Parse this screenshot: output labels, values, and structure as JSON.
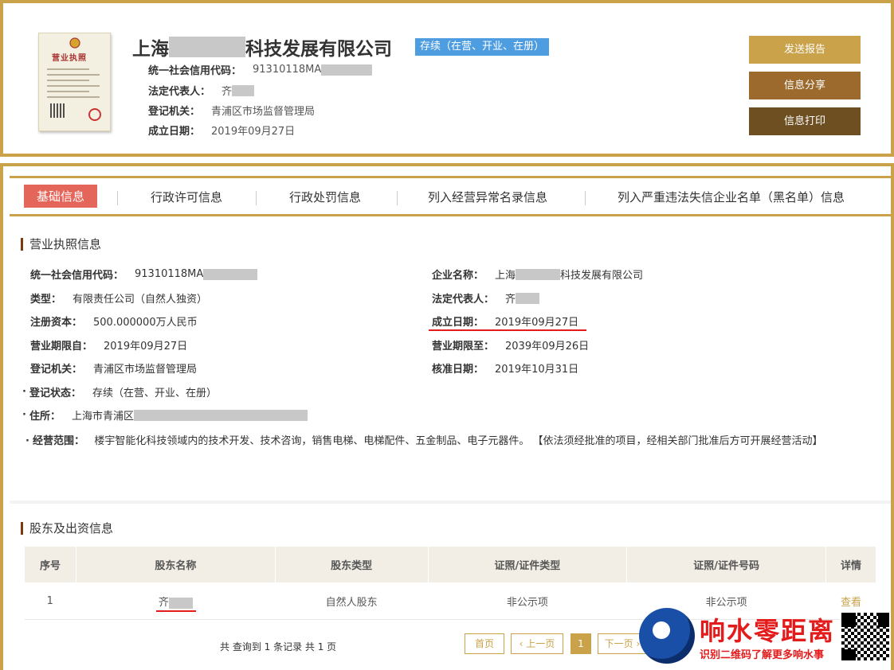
{
  "header": {
    "license_title": "营业执照",
    "company_prefix": "上海",
    "company_suffix": "科技发展有限公司",
    "status": "存续（在营、开业、在册）",
    "credit_code_label": "统一社会信用代码：",
    "credit_code": "91310118MA",
    "legal_rep_label": "法定代表人：",
    "legal_rep": "齐",
    "authority_label": "登记机关：",
    "authority": "青浦区市场监督管理局",
    "founded_label": "成立日期：",
    "founded": "2019年09月27日"
  },
  "actions": {
    "send": "发送报告",
    "share": "信息分享",
    "print": "信息打印"
  },
  "tabs": [
    "基础信息",
    "行政许可信息",
    "行政处罚信息",
    "列入经营异常名录信息",
    "列入严重违法失信企业名单（黑名单）信息"
  ],
  "license_section": {
    "title": "营业执照信息",
    "credit_code_label": "统一社会信用代码：",
    "credit_code": "91310118MA",
    "name_label": "企业名称：",
    "name_prefix": "上海",
    "name_suffix": "科技发展有限公司",
    "type_label": "类型：",
    "type": "有限责任公司（自然人独资）",
    "legal_rep_label": "法定代表人：",
    "legal_rep": "齐",
    "capital_label": "注册资本：",
    "capital": "500.000000万人民币",
    "founded_label": "成立日期：",
    "founded": "2019年09月27日",
    "term_from_label": "营业期限自：",
    "term_from": "2019年09月27日",
    "term_to_label": "营业期限至：",
    "term_to": "2039年09月26日",
    "authority_label": "登记机关：",
    "authority": "青浦区市场监督管理局",
    "approved_label": "核准日期：",
    "approved": "2019年10月31日",
    "reg_status_label": "登记状态：",
    "reg_status": "存续（在营、开业、在册）",
    "address_label": "住所：",
    "address": "上海市青浦区",
    "scope_label": "经营范围：",
    "scope": "楼宇智能化科技领域内的技术开发、技术咨询，销售电梯、电梯配件、五金制品、电子元器件。 【依法须经批准的项目，经相关部门批准后方可开展经营活动】"
  },
  "shareholder_section": {
    "title": "股东及出资信息",
    "columns": [
      "序号",
      "股东名称",
      "股东类型",
      "证照/证件类型",
      "证照/证件号码",
      "详情"
    ],
    "rows": [
      {
        "index": "1",
        "name": "齐",
        "type": "自然人股东",
        "cert_type": "非公示项",
        "cert_no": "非公示项",
        "detail": "查看"
      }
    ]
  },
  "pager": {
    "summary": "共 查询到 1 条记录 共 1 页",
    "first": "首页",
    "prev": "上一页",
    "current": "1",
    "next": "下一页"
  },
  "watermark": {
    "title": "响水零距离",
    "subtitle": "识别二维码了解更多响水事"
  },
  "colors": {
    "gold": "#c9a24a",
    "brown": "#9b6a2c",
    "dark_brown": "#6e4f21",
    "active_tab": "#e4655a",
    "status_blue": "#4d9de0",
    "underline_red": "#e31b1b"
  }
}
